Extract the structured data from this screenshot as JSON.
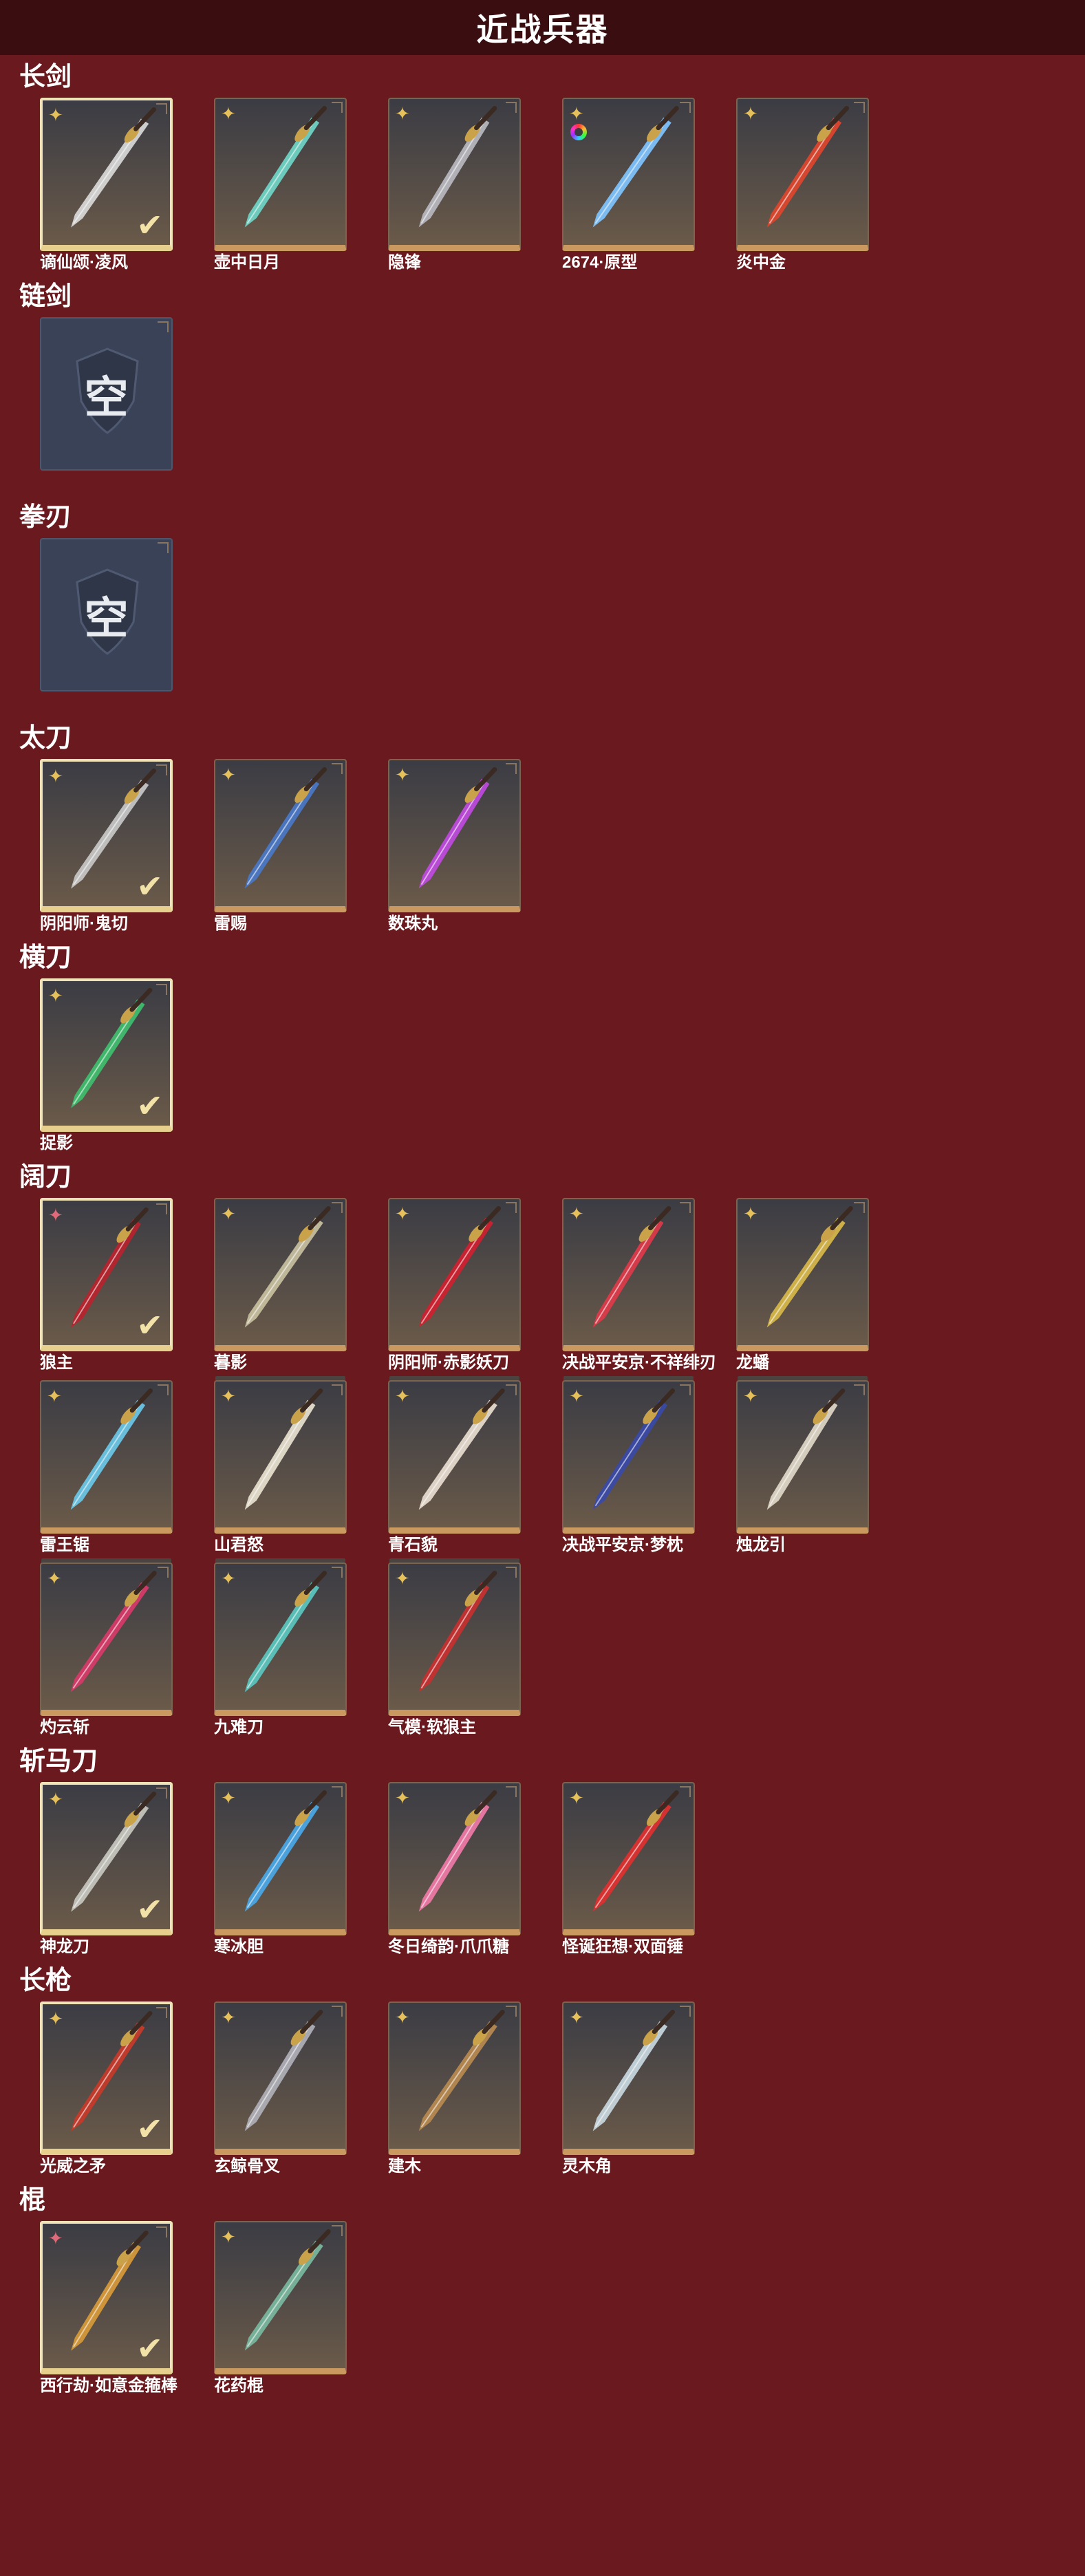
{
  "header": {
    "title": "近战兵器"
  },
  "empty_label": "空",
  "categories": [
    {
      "title": "长剑",
      "items": [
        {
          "name": "谪仙颂·凌风",
          "equipped": true,
          "rank": "gold",
          "color": "#d9d9d9"
        },
        {
          "name": "壶中日月",
          "equipped": false,
          "rank": "gold",
          "color": "#6fd6c8"
        },
        {
          "name": "隐锋",
          "equipped": false,
          "rank": "gold",
          "color": "#b8b8c0"
        },
        {
          "name": "2674·原型",
          "equipped": false,
          "rank": "gold-rainbow",
          "color": "#7fc4ff"
        },
        {
          "name": "炎中金",
          "equipped": false,
          "rank": "gold",
          "color": "#e0452e"
        }
      ]
    },
    {
      "title": "链剑",
      "items": [
        {
          "empty": true
        }
      ]
    },
    {
      "title": "拳刃",
      "items": [
        {
          "empty": true
        }
      ]
    },
    {
      "title": "太刀",
      "items": [
        {
          "name": "阴阳师·鬼切",
          "equipped": true,
          "rank": "gold",
          "color": "#c8c8c8"
        },
        {
          "name": "雷赐",
          "equipped": false,
          "rank": "gold",
          "color": "#4a78c8"
        },
        {
          "name": "数珠丸",
          "equipped": false,
          "rank": "gold",
          "color": "#c04adf"
        }
      ]
    },
    {
      "title": "横刀",
      "items": [
        {
          "name": "捉影",
          "equipped": true,
          "rank": "gold",
          "color": "#3fbf6f"
        }
      ]
    },
    {
      "title": "阔刀",
      "items": [
        {
          "name": "狼主",
          "equipped": true,
          "rank": "red",
          "color": "#b8232e"
        },
        {
          "name": "暮影",
          "equipped": false,
          "rank": "gold",
          "color": "#c8c0a0"
        },
        {
          "name": "阴阳师·赤影妖刀",
          "equipped": false,
          "rank": "gold",
          "color": "#d02030"
        },
        {
          "name": "决战平安京·不祥绯刃",
          "equipped": false,
          "rank": "gold",
          "color": "#e03a4a"
        },
        {
          "name": "龙蟠",
          "equipped": false,
          "rank": "gold",
          "color": "#d8b84a"
        },
        {
          "name": "雷王锯",
          "equipped": false,
          "rank": "gold",
          "color": "#6ac8e8"
        },
        {
          "name": "山君怒",
          "equipped": false,
          "rank": "gold",
          "color": "#e8e2d0"
        },
        {
          "name": "青石貌",
          "equipped": false,
          "rank": "gold",
          "color": "#e8ddd0"
        },
        {
          "name": "决战平安京·梦枕",
          "equipped": false,
          "rank": "gold",
          "color": "#3a4aa8"
        },
        {
          "name": "烛龙引",
          "equipped": false,
          "rank": "gold",
          "color": "#e0d8c8"
        },
        {
          "name": "灼云斩",
          "equipped": false,
          "rank": "gold",
          "color": "#d83a6a"
        },
        {
          "name": "九难刀",
          "equipped": false,
          "rank": "gold",
          "color": "#5ac8c0"
        },
        {
          "name": "气模·软狼主",
          "equipped": false,
          "rank": "gold",
          "color": "#c83030"
        }
      ]
    },
    {
      "title": "斩马刀",
      "items": [
        {
          "name": "神龙刀",
          "equipped": true,
          "rank": "gold",
          "color": "#c8c8c0"
        },
        {
          "name": "寒冰胆",
          "equipped": false,
          "rank": "gold",
          "color": "#4aa8e8"
        },
        {
          "name": "冬日绮韵·爪爪糖",
          "equipped": false,
          "rank": "gold",
          "color": "#f07aa8"
        },
        {
          "name": "怪诞狂想·双面锤",
          "equipped": false,
          "rank": "gold",
          "color": "#e03030"
        }
      ]
    },
    {
      "title": "长枪",
      "items": [
        {
          "name": "光威之矛",
          "equipped": true,
          "rank": "gold",
          "color": "#c83a2a"
        },
        {
          "name": "玄鲸骨叉",
          "equipped": false,
          "rank": "gold",
          "color": "#b0b0b8"
        },
        {
          "name": "建木",
          "equipped": false,
          "rank": "gold",
          "color": "#b88a50"
        },
        {
          "name": "灵木角",
          "equipped": false,
          "rank": "gold",
          "color": "#c8d8e0"
        }
      ]
    },
    {
      "title": "棍",
      "items": [
        {
          "name": "西行劫·如意金箍棒",
          "equipped": true,
          "rank": "red",
          "color": "#d89a3a"
        },
        {
          "name": "花药棍",
          "equipped": false,
          "rank": "gold",
          "color": "#7ab8a0"
        }
      ]
    }
  ]
}
